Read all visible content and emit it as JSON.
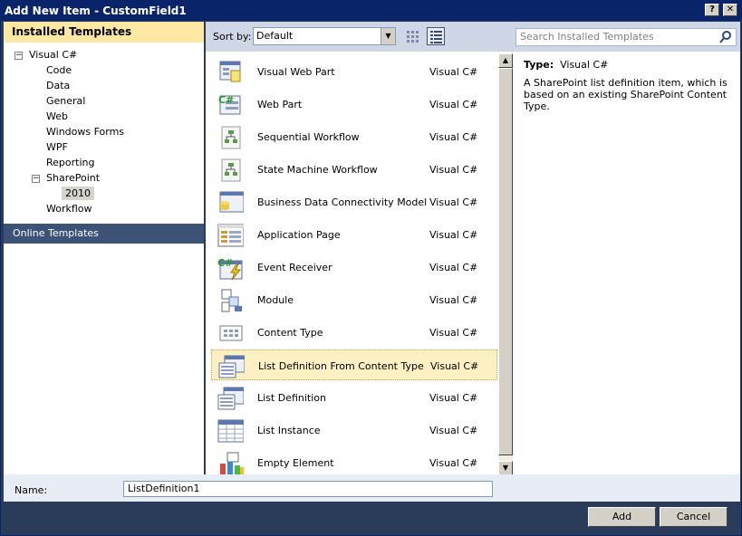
{
  "window": {
    "title": "Add New Item - CustomField1"
  },
  "left": {
    "header": "Installed Templates",
    "tree": [
      {
        "label": "Visual C#",
        "expanded": true
      },
      {
        "label": "Code"
      },
      {
        "label": "Data"
      },
      {
        "label": "General"
      },
      {
        "label": "Web"
      },
      {
        "label": "Windows Forms"
      },
      {
        "label": "WPF"
      },
      {
        "label": "Reporting"
      },
      {
        "label": "SharePoint",
        "expanded": true
      },
      {
        "label": "2010",
        "selected": true
      },
      {
        "label": "Workflow"
      }
    ],
    "online": "Online Templates"
  },
  "toolbar": {
    "sortby_label": "Sort by:",
    "sortby_value": "Default"
  },
  "search": {
    "placeholder": "Search Installed Templates"
  },
  "templates": [
    {
      "name": "Visual Web Part",
      "lang": "Visual C#",
      "icon": "web-part-icon"
    },
    {
      "name": "Web Part",
      "lang": "Visual C#",
      "icon": "csharp-web-part-icon"
    },
    {
      "name": "Sequential Workflow",
      "lang": "Visual C#",
      "icon": "workflow-icon"
    },
    {
      "name": "State Machine Workflow",
      "lang": "Visual C#",
      "icon": "workflow-icon"
    },
    {
      "name": "Business Data Connectivity Model",
      "lang": "Visual C#",
      "icon": "bdc-model-icon"
    },
    {
      "name": "Application Page",
      "lang": "Visual C#",
      "icon": "application-page-icon"
    },
    {
      "name": "Event Receiver",
      "lang": "Visual C#",
      "icon": "event-receiver-icon"
    },
    {
      "name": "Module",
      "lang": "Visual C#",
      "icon": "module-icon"
    },
    {
      "name": "Content Type",
      "lang": "Visual C#",
      "icon": "content-type-icon"
    },
    {
      "name": "List Definition From Content Type",
      "lang": "Visual C#",
      "icon": "list-definition-icon",
      "selected": true
    },
    {
      "name": "List Definition",
      "lang": "Visual C#",
      "icon": "list-definition-icon"
    },
    {
      "name": "List Instance",
      "lang": "Visual C#",
      "icon": "list-instance-icon"
    },
    {
      "name": "Empty Element",
      "lang": "Visual C#",
      "icon": "empty-element-icon"
    }
  ],
  "detail": {
    "type_label": "Type:",
    "type_value": "Visual C#",
    "description": "A SharePoint list definition item, which is based on an existing SharePoint Content Type."
  },
  "namebar": {
    "label": "Name:",
    "value": "ListDefinition1"
  },
  "buttons": {
    "add": "Add",
    "cancel": "Cancel"
  },
  "titlebar_buttons": {
    "help": "?",
    "close": "✕"
  },
  "colors": {
    "title_bg": "#0a246a",
    "selected_row": "#fdf1c3",
    "header_yellow": "#fde8a4",
    "online_bg": "#3d5277"
  }
}
